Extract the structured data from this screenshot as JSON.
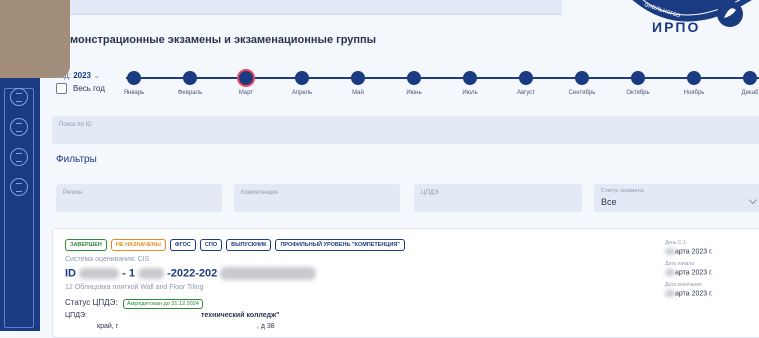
{
  "page_title": "монстрационные экзамены и экзаменационные группы",
  "logo": {
    "text": "ИРПО",
    "arc_text": "ональногоо"
  },
  "year_filter": {
    "label": "Год:",
    "value": "2023",
    "chevron": "chevron-down-icon"
  },
  "all_year_checkbox": {
    "label": "Весь год",
    "checked": false
  },
  "months": [
    {
      "label": "Январь",
      "active": false
    },
    {
      "label": "Февраль",
      "active": false
    },
    {
      "label": "Март",
      "active": true
    },
    {
      "label": "Апрель",
      "active": false
    },
    {
      "label": "Май",
      "active": false
    },
    {
      "label": "Июнь",
      "active": false
    },
    {
      "label": "Июль",
      "active": false
    },
    {
      "label": "Август",
      "active": false
    },
    {
      "label": "Сентябрь",
      "active": false
    },
    {
      "label": "Октябрь",
      "active": false
    },
    {
      "label": "Ноябрь",
      "active": false
    },
    {
      "label": "Декаб",
      "active": false
    }
  ],
  "search": {
    "placeholder": "Поиск по ID"
  },
  "filters": {
    "title": "Фильтры",
    "region": "Регион",
    "competence": "Компетенция",
    "center": "ЦПДЭ",
    "status_label": "Статус экзамена",
    "status_value": "Все"
  },
  "card": {
    "badges": [
      "ЗАВЕРШЕН",
      "НЕ НАЗНАЧЕНЫ",
      "ФГОС",
      "СПО",
      "ВЫПУСКНИК",
      "ПРОФИЛЬНЫЙ УРОВЕНЬ \"КОМПЕТЕНЦИЯ\""
    ],
    "eval_system": "Система оценивания: CIS",
    "id_prefix": "ID",
    "id_mid1": "- 1",
    "id_mid2": "-2022-202",
    "skill": "12  Облицовка плиткой  Wall and Floor Tiling",
    "status_label": "Статус ЦПДЭ:",
    "status_value": "Аккредитован до 31.12.2024",
    "center_label": "ЦПДЭ:",
    "center_value": "технический колледж\"",
    "address_part1": "край, г",
    "address_part2": ", д 38",
    "day_c1_label": "День С-1",
    "day_c1_value": "арта 2023 г.",
    "start_label": "Дата начала",
    "start_value": "арта 2023 г.",
    "end_label": "Дата окончания",
    "end_value": "арта 2023 г."
  },
  "colors": {
    "brand": "#1a3b82",
    "active_ring": "#e84b5b",
    "green": "#2e8b3a",
    "orange": "#e88b1c"
  }
}
